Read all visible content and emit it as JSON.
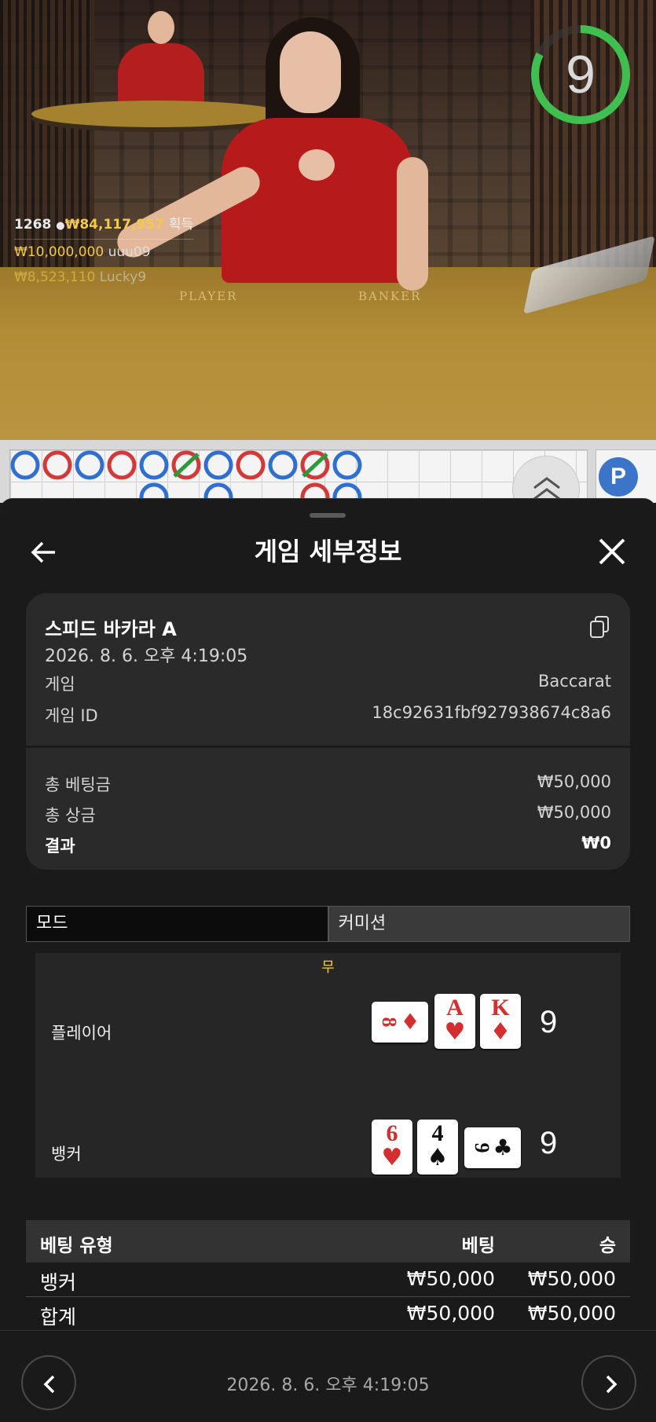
{
  "video": {
    "stats": {
      "players": "1268",
      "total_won": "₩84,117,957",
      "won_label": "획득",
      "top1_amount": "₩10,000,000",
      "top1_name": "uuu09",
      "top2_amount": "₩8,523,110",
      "top2_name": "Lucky9"
    },
    "timer": "9",
    "table_labels": {
      "player": "PLAYER",
      "banker": "BANKER"
    }
  },
  "roadmap": {
    "badge": "P"
  },
  "sheet": {
    "title": "게임 세부정보",
    "summary": {
      "game_name": "스피드 바카라 A",
      "datetime": "2026. 8. 6. 오후 4:19:05",
      "game_label": "게임",
      "game_value": "Baccarat",
      "game_id_label": "게임 ID",
      "game_id_value": "18c92631fbf927938674c8a6",
      "total_bet_label": "총 베팅금",
      "total_bet_value": "₩50,000",
      "total_payout_label": "총 상금",
      "total_payout_value": "₩50,000",
      "result_label": "결과",
      "result_value": "₩0"
    },
    "tabs": {
      "mode": "모드",
      "commission": "커미션"
    },
    "result": {
      "outcome": "무",
      "player_label": "플레이어",
      "player_total": "9",
      "player_cards": [
        {
          "rank": "8",
          "suit": "♦",
          "color": "red"
        },
        {
          "rank": "A",
          "suit": "♥",
          "color": "red"
        },
        {
          "rank": "K",
          "suit": "♦",
          "color": "red"
        }
      ],
      "banker_label": "뱅커",
      "banker_total": "9",
      "banker_cards": [
        {
          "rank": "6",
          "suit": "♥",
          "color": "red"
        },
        {
          "rank": "4",
          "suit": "♠",
          "color": "black"
        },
        {
          "rank": "9",
          "suit": "♣",
          "color": "black"
        }
      ]
    },
    "bets": {
      "headers": {
        "type": "베팅 유형",
        "bet": "베팅",
        "win": "승"
      },
      "rows": [
        {
          "type": "뱅커",
          "bet": "₩50,000",
          "win": "₩50,000"
        }
      ],
      "total": {
        "type": "합계",
        "bet": "₩50,000",
        "win": "₩50,000"
      }
    },
    "footer_datetime": "2026. 8. 6. 오후 4:19:05"
  },
  "colors": {
    "accent_gold": "#f2c94c",
    "card_red": "#d32f2f",
    "timer_green": "#3fbf4f",
    "roadmap_player_blue": "#2f6fd0",
    "roadmap_banker_red": "#d23a3a"
  }
}
